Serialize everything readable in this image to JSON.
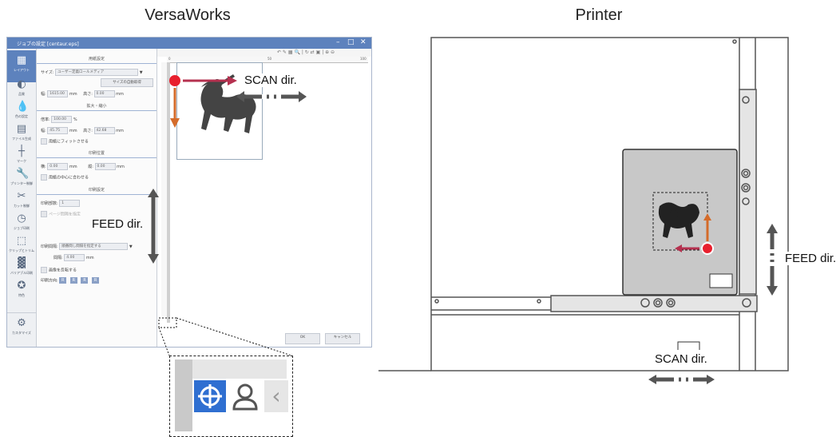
{
  "headings": {
    "left": "VersaWorks",
    "right": "Printer"
  },
  "window": {
    "title": "ジョブの設定 [centaur.eps]",
    "controls": [
      "–",
      "□",
      "✕"
    ],
    "ok": "OK",
    "cancel": "キャンセル"
  },
  "sidebar": {
    "items": [
      {
        "label": "レイアウト",
        "icon": "layout-icon"
      },
      {
        "label": "品質",
        "icon": "quality-icon"
      },
      {
        "label": "色の設定",
        "icon": "color-icon"
      },
      {
        "label": "ファイル生成",
        "icon": "file-icon"
      },
      {
        "label": "マーク",
        "icon": "mark-icon"
      },
      {
        "label": "プリンター制御",
        "icon": "wrench-icon"
      },
      {
        "label": "カット制御",
        "icon": "scissors-icon"
      },
      {
        "label": "ジョブ印刷",
        "icon": "clock-icon"
      },
      {
        "label": "クリップとトリム",
        "icon": "crop-icon"
      },
      {
        "label": "バリアブル印刷",
        "icon": "variable-icon"
      },
      {
        "label": "特色",
        "icon": "special-color-icon"
      }
    ],
    "bottom": "カスタマイズ"
  },
  "panel": {
    "media": {
      "header": "用紙設定",
      "size_label": "サイズ:",
      "size_value": "ユーザー定義ロールメディア",
      "auto_button": "サイズの自動取得",
      "width_label": "幅:",
      "width_value": "1615.00",
      "height_label": "高さ:",
      "height_value": "0.00",
      "unit": "mm"
    },
    "scale": {
      "header": "拡大・縮小",
      "ratio_label": "倍率:",
      "ratio_value": "100.00",
      "ratio_unit": "%",
      "width_label": "幅:",
      "width_value": "45.75",
      "height_label": "高さ:",
      "height_value": "42.68",
      "unit": "mm",
      "fit_label": "用紙にフィットさせる"
    },
    "position": {
      "header": "印刷位置",
      "x_label": "横:",
      "x_value": "0.00",
      "y_label": "縦:",
      "y_value": "0.00",
      "unit": "mm",
      "center_label": "用紙の中心に合わせる"
    },
    "print": {
      "header": "印刷設定",
      "copies_label": "印刷部数:",
      "copies_value": "1",
      "page_setting_label": "ページ間隔を指定",
      "interval_label": "印刷間隔:",
      "interval_value": "順番間し間隔を指定する",
      "gap_label": "間隔:",
      "gap_value": "4.00",
      "unit": "mm",
      "mirror_label": "画像を反転する",
      "direction_label": "印刷方向:"
    }
  },
  "canvas": {
    "ruler_marks": [
      "0",
      "50",
      "100"
    ]
  },
  "annotations": {
    "scan_left": "SCAN dir.",
    "feed_left": "FEED dir.",
    "feed_right": "FEED dir.",
    "scan_right": "SCAN dir."
  },
  "colors": {
    "origin": "#e8202e",
    "scan_arrow": "#b5314f",
    "feed_arrow": "#d46b2a",
    "title_bar": "#5d82bd",
    "active_tool": "#2f6fd1"
  }
}
